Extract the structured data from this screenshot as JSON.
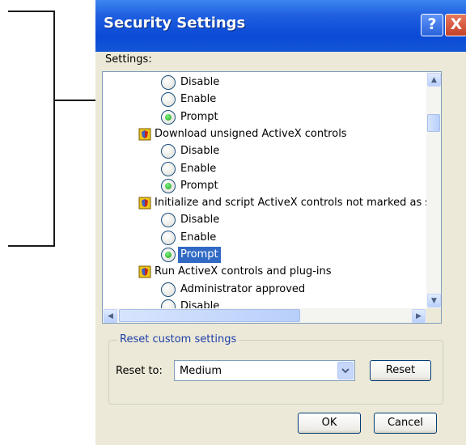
{
  "dialog": {
    "title": "Security Settings",
    "help_button": "?",
    "close_button": "X"
  },
  "settings": {
    "label": "Settings:",
    "rows": [
      {
        "kind": "option",
        "label": "Disable",
        "checked": false
      },
      {
        "kind": "option",
        "label": "Enable",
        "checked": false
      },
      {
        "kind": "option",
        "label": "Prompt",
        "checked": true
      },
      {
        "kind": "category",
        "label": "Download unsigned ActiveX controls"
      },
      {
        "kind": "option",
        "label": "Disable",
        "checked": false
      },
      {
        "kind": "option",
        "label": "Enable",
        "checked": false
      },
      {
        "kind": "option",
        "label": "Prompt",
        "checked": true
      },
      {
        "kind": "category",
        "label": "Initialize and script ActiveX controls not marked as safe"
      },
      {
        "kind": "option",
        "label": "Disable",
        "checked": false
      },
      {
        "kind": "option",
        "label": "Enable",
        "checked": false
      },
      {
        "kind": "option",
        "label": "Prompt",
        "checked": true,
        "selected": true
      },
      {
        "kind": "category",
        "label": "Run ActiveX controls and plug-ins"
      },
      {
        "kind": "option",
        "label": "Administrator approved",
        "checked": false
      },
      {
        "kind": "option",
        "label": "Disable",
        "checked": false
      }
    ]
  },
  "reset_group": {
    "legend": "Reset custom settings",
    "reset_to_label": "Reset to:",
    "reset_to_value": "Medium",
    "reset_button": "Reset"
  },
  "buttons": {
    "ok": "OK",
    "cancel": "Cancel"
  },
  "colors": {
    "accent": "#0a4ad6",
    "selection": "#316ac5",
    "radio_checked": "#21a121"
  }
}
